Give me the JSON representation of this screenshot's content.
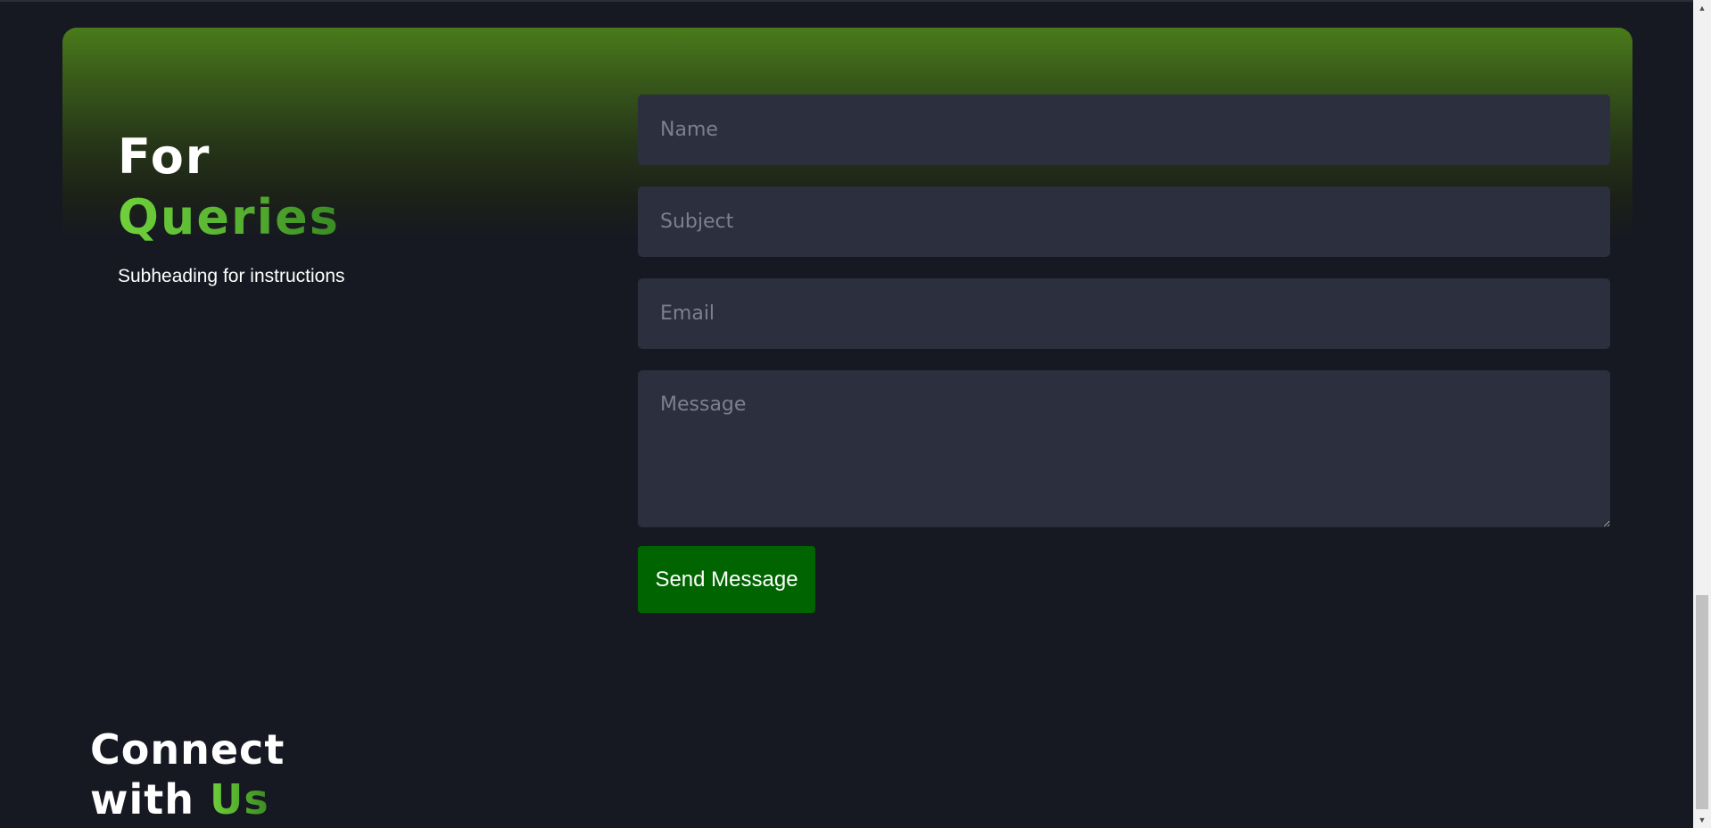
{
  "queries": {
    "title_line1": "For",
    "title_line2": "Queries",
    "subheading": "Subheading for instructions"
  },
  "form": {
    "name_placeholder": "Name",
    "subject_placeholder": "Subject",
    "email_placeholder": "Email",
    "message_placeholder": "Message",
    "submit_label": "Send Message"
  },
  "connect": {
    "line1": "Connect",
    "line2_prefix": "with",
    "line2_highlight": "Us"
  },
  "scrollbar": {
    "up_arrow": "▲",
    "down_arrow": "▼"
  },
  "colors": {
    "background": "#161822",
    "accent_green": "#5fc235",
    "button": "#006400",
    "field": "#2c2f3d"
  }
}
